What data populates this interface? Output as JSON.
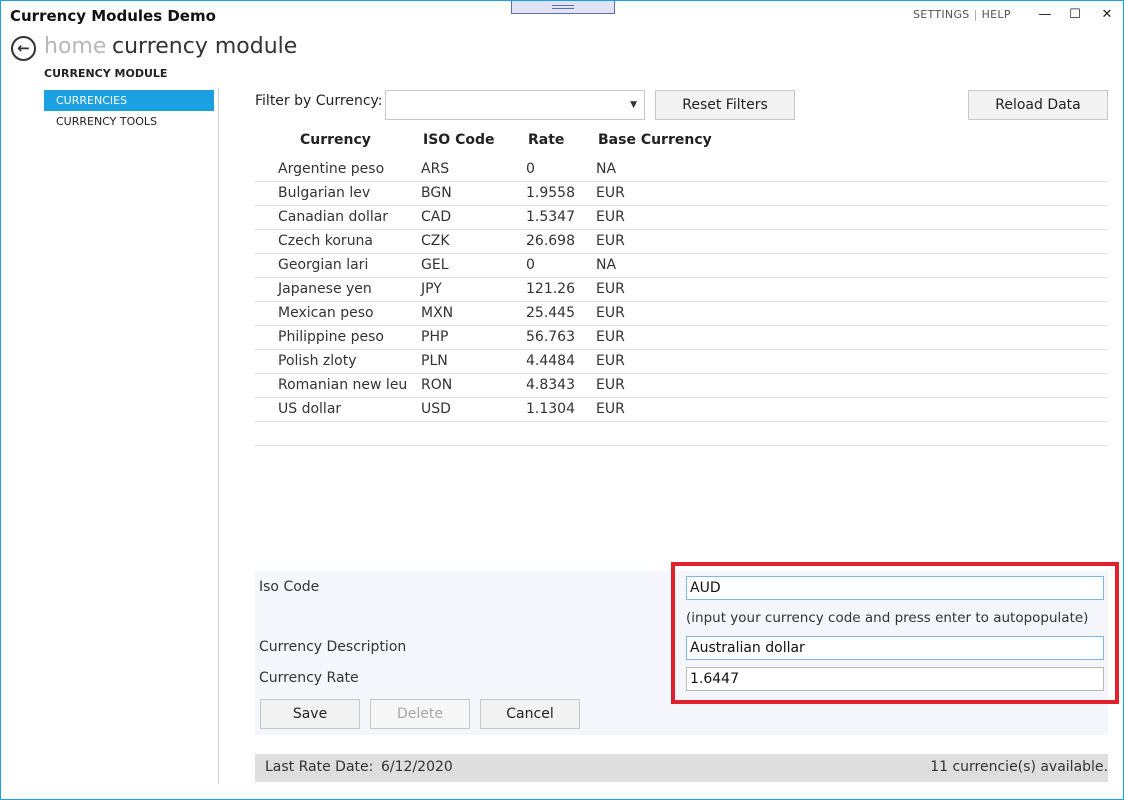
{
  "window": {
    "title": "Currency Modules Demo",
    "settings_label": "SETTINGS",
    "help_label": "HELP",
    "separator": "|",
    "minimize_glyph": "—",
    "maximize_glyph": "☐",
    "close_glyph": "✕"
  },
  "header": {
    "back_glyph": "←",
    "breadcrumb_home": "home",
    "breadcrumb_current": "currency module",
    "section_title": "CURRENCY MODULE"
  },
  "sidebar": {
    "items": [
      {
        "label": "CURRENCIES"
      },
      {
        "label": "CURRENCY TOOLS"
      }
    ]
  },
  "filter": {
    "label": "Filter by Currency:",
    "selected": "",
    "reset_label": "Reset Filters",
    "reload_label": "Reload Data"
  },
  "table": {
    "columns": [
      "Currency",
      "ISO Code",
      "Rate",
      "Base Currency"
    ],
    "rows": [
      [
        "Argentine peso",
        "ARS",
        "0",
        "NA"
      ],
      [
        "Bulgarian lev",
        "BGN",
        "1.9558",
        "EUR"
      ],
      [
        "Canadian dollar",
        "CAD",
        "1.5347",
        "EUR"
      ],
      [
        "Czech koruna",
        "CZK",
        "26.698",
        "EUR"
      ],
      [
        "Georgian lari",
        "GEL",
        "0",
        "NA"
      ],
      [
        "Japanese yen",
        "JPY",
        "121.26",
        "EUR"
      ],
      [
        "Mexican peso",
        "MXN",
        "25.445",
        "EUR"
      ],
      [
        "Philippine peso",
        "PHP",
        "56.763",
        "EUR"
      ],
      [
        "Polish zloty",
        "PLN",
        "4.4484",
        "EUR"
      ],
      [
        "Romanian new leu",
        "RON",
        "4.8343",
        "EUR"
      ],
      [
        "US dollar",
        "USD",
        "1.1304",
        "EUR"
      ]
    ]
  },
  "edit": {
    "iso_label": "Iso Code",
    "iso_value": "AUD",
    "hint": "(input your currency code and press enter to autopopulate)",
    "desc_label": "Currency Description",
    "desc_value": "Australian dollar",
    "rate_label": "Currency Rate",
    "rate_value": "1.6447",
    "save_label": "Save",
    "delete_label": "Delete",
    "cancel_label": "Cancel"
  },
  "status": {
    "last_rate_label": "Last Rate Date:",
    "last_rate_date": "6/12/2020",
    "count_text": "11 currencie(s) available."
  },
  "colors": {
    "accent": "#1ba1e2",
    "highlight": "#e0202a"
  }
}
